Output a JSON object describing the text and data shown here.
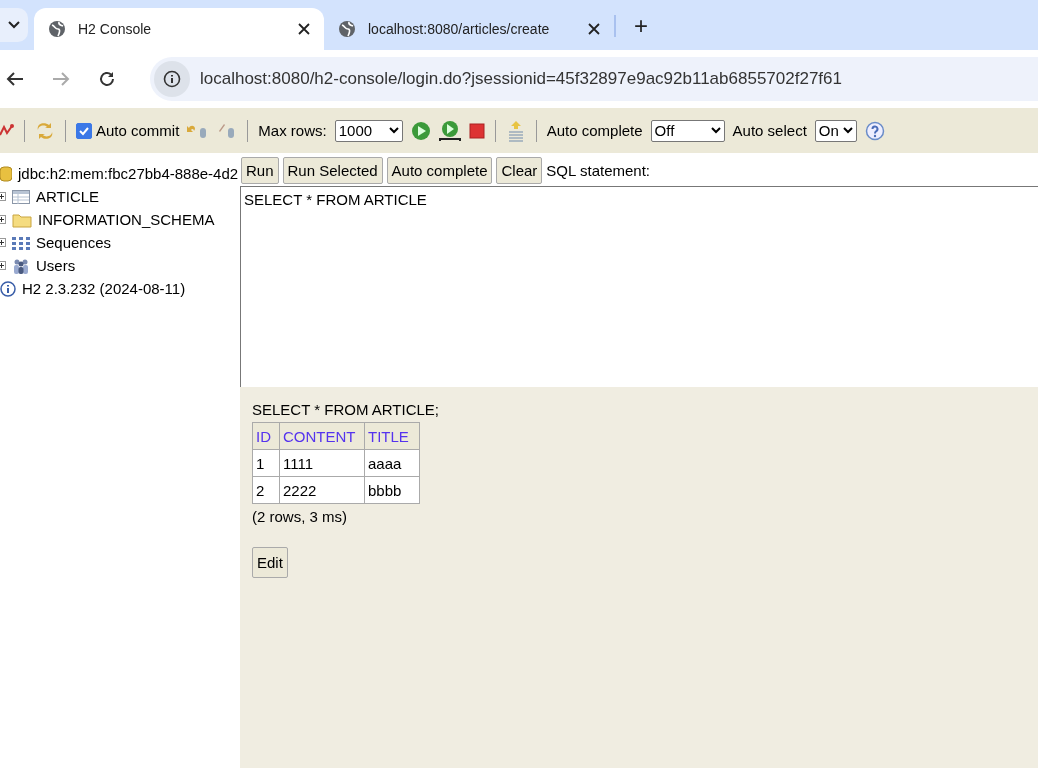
{
  "browser": {
    "tabs": [
      {
        "title": "H2 Console",
        "selected": true
      },
      {
        "title": "localhost:8080/articles/create",
        "selected": false
      }
    ],
    "new_tab": "+",
    "url": "localhost:8080/h2-console/login.do?jsessionid=45f32897e9ac92b11ab6855702f27f61"
  },
  "toolbar": {
    "auto_commit": {
      "label": "Auto commit",
      "checked": true
    },
    "max_rows": {
      "label": "Max rows:",
      "value": "1000"
    },
    "auto_complete": {
      "label": "Auto complete",
      "value": "Off"
    },
    "auto_select": {
      "label": "Auto select",
      "value": "On"
    }
  },
  "tree": {
    "root": "jdbc:h2:mem:fbc27bb4-888e-4d2",
    "items": [
      {
        "label": "ARTICLE",
        "kind": "table",
        "expanded": false
      },
      {
        "label": "INFORMATION_SCHEMA",
        "kind": "folder",
        "expanded": false
      },
      {
        "label": "Sequences",
        "kind": "sequences",
        "expanded": false
      },
      {
        "label": "Users",
        "kind": "users",
        "expanded": false
      }
    ],
    "version": "H2 2.3.232 (2024-08-11)"
  },
  "buttons": [
    "Run",
    "Run Selected",
    "Auto complete",
    "Clear"
  ],
  "sql_label": "SQL statement:",
  "sql": "SELECT * FROM ARTICLE",
  "result": {
    "statement": "SELECT * FROM ARTICLE;",
    "columns": [
      "ID",
      "CONTENT",
      "TITLE"
    ],
    "rows": [
      [
        "1",
        "1111",
        "aaaa"
      ],
      [
        "2",
        "2222",
        "bbbb"
      ]
    ],
    "summary": "(2 rows, 3 ms)",
    "edit": "Edit"
  }
}
